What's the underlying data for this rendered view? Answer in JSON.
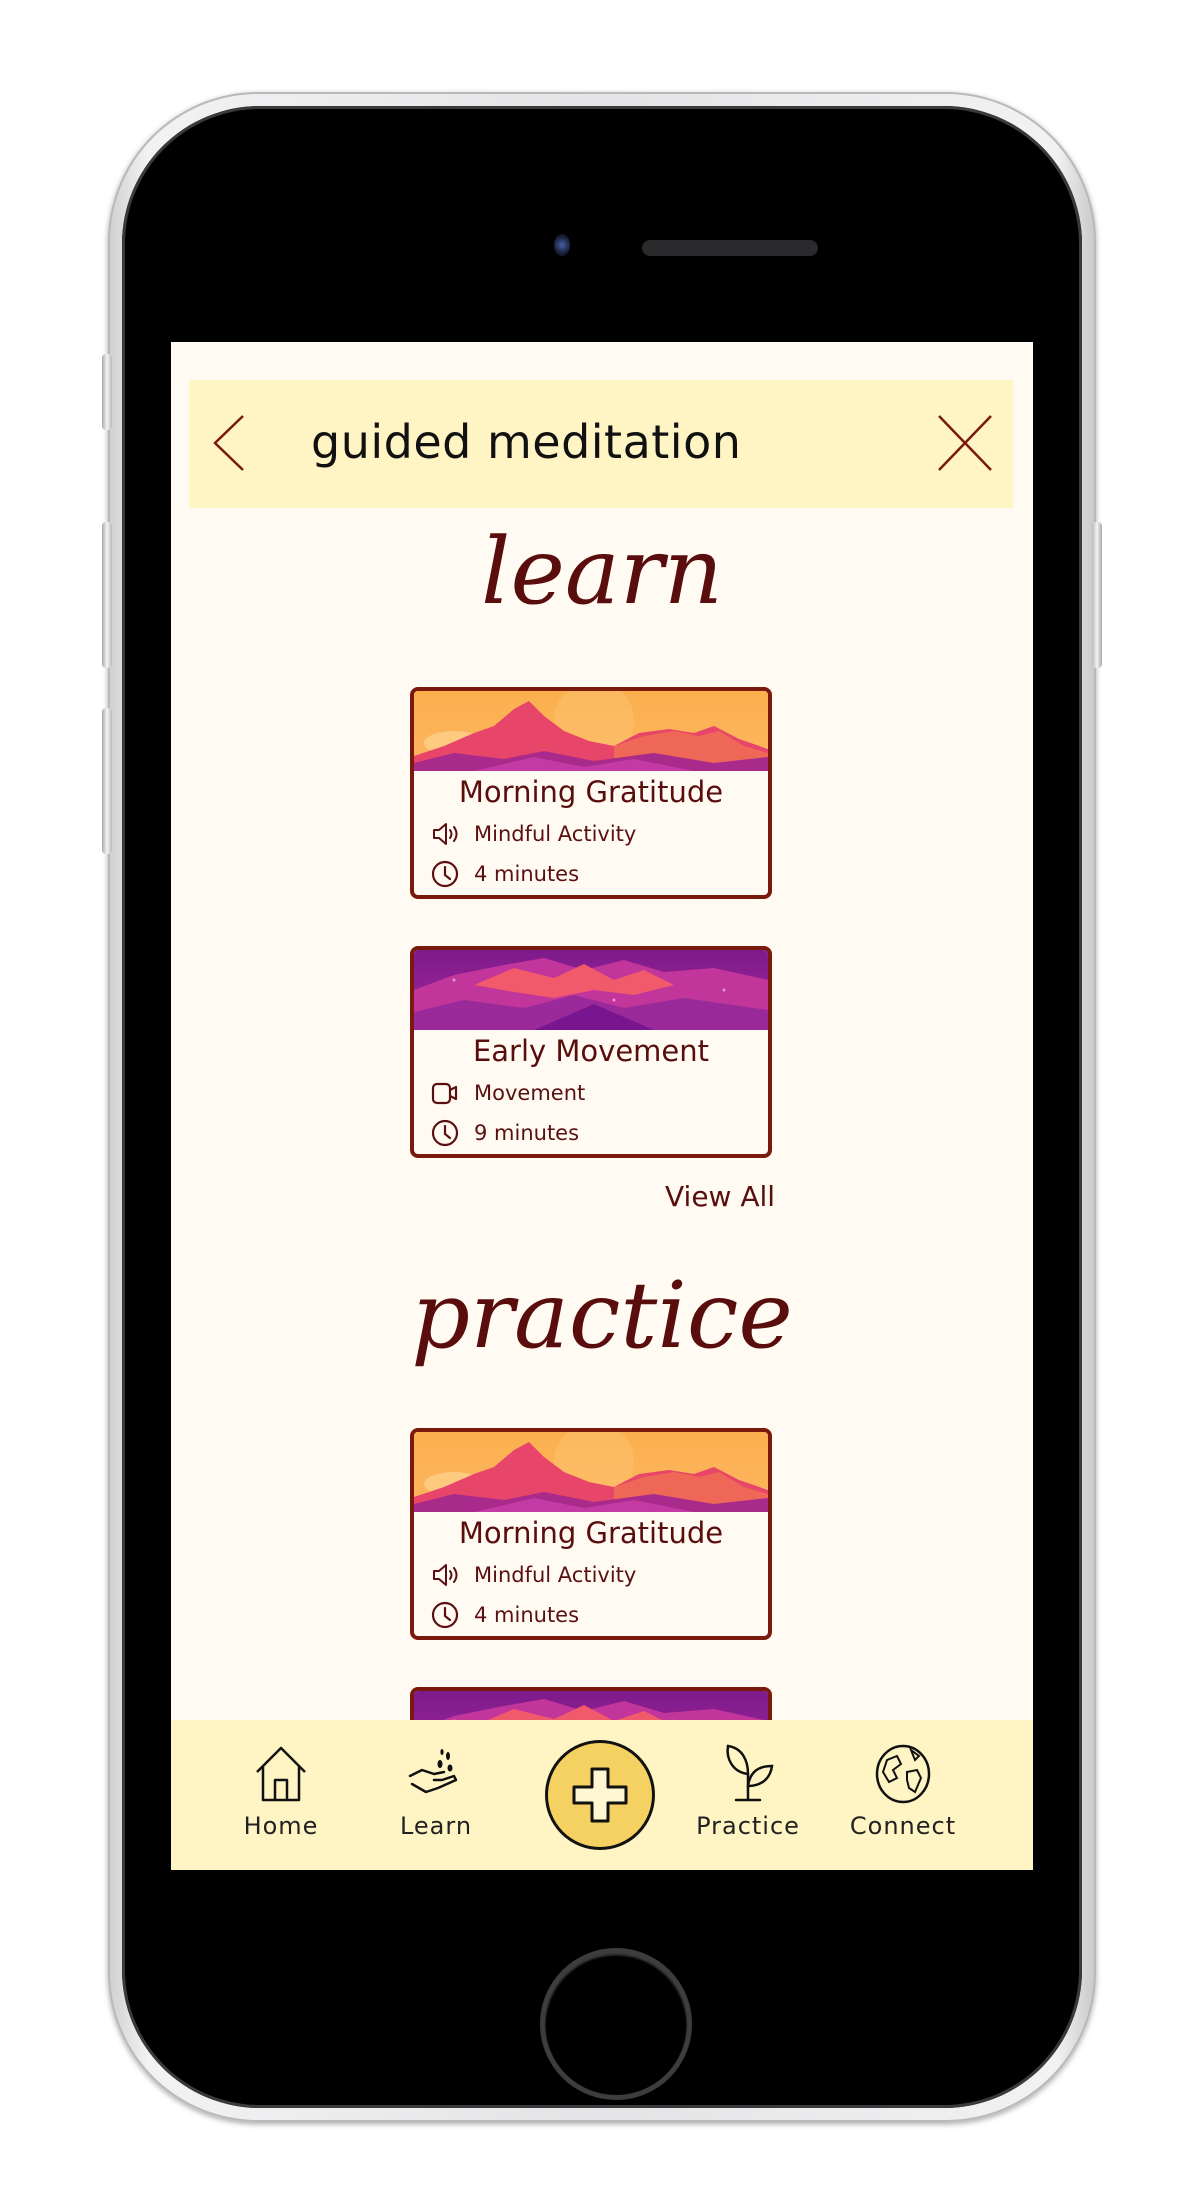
{
  "header": {
    "title": "guided meditation",
    "back_icon": "chevron-left-icon",
    "close_icon": "close-icon"
  },
  "sections": [
    {
      "heading": "learn",
      "cards": [
        {
          "title": "Morning Gratitude",
          "type": "Mindful Activity",
          "type_icon": "speaker-icon",
          "duration": "4 minutes",
          "art": "sunrise-mountains"
        },
        {
          "title": "Early Movement",
          "type": "Movement",
          "type_icon": "video-camera-icon",
          "duration": "9 minutes",
          "art": "purple-mountains"
        }
      ],
      "view_all": "View All"
    },
    {
      "heading": "practice",
      "cards": [
        {
          "title": "Morning Gratitude",
          "type": "Mindful Activity",
          "type_icon": "speaker-icon",
          "duration": "4 minutes",
          "art": "sunrise-mountains"
        },
        {
          "art": "purple-mountains"
        }
      ]
    }
  ],
  "nav": {
    "items": [
      {
        "label": "Home",
        "icon": "home-icon"
      },
      {
        "label": "Learn",
        "icon": "hand-seeds-icon"
      },
      {
        "label": "",
        "icon": "plus-icon"
      },
      {
        "label": "Practice",
        "icon": "sprout-icon"
      },
      {
        "label": "Connect",
        "icon": "globe-icon"
      }
    ]
  },
  "colors": {
    "accent_dark": "#5a0d0d",
    "card_border": "#7a1a0c",
    "bar_bg": "#fff4c4",
    "screen_bg": "#fffbf3",
    "plus_fill": "#f4d160"
  }
}
